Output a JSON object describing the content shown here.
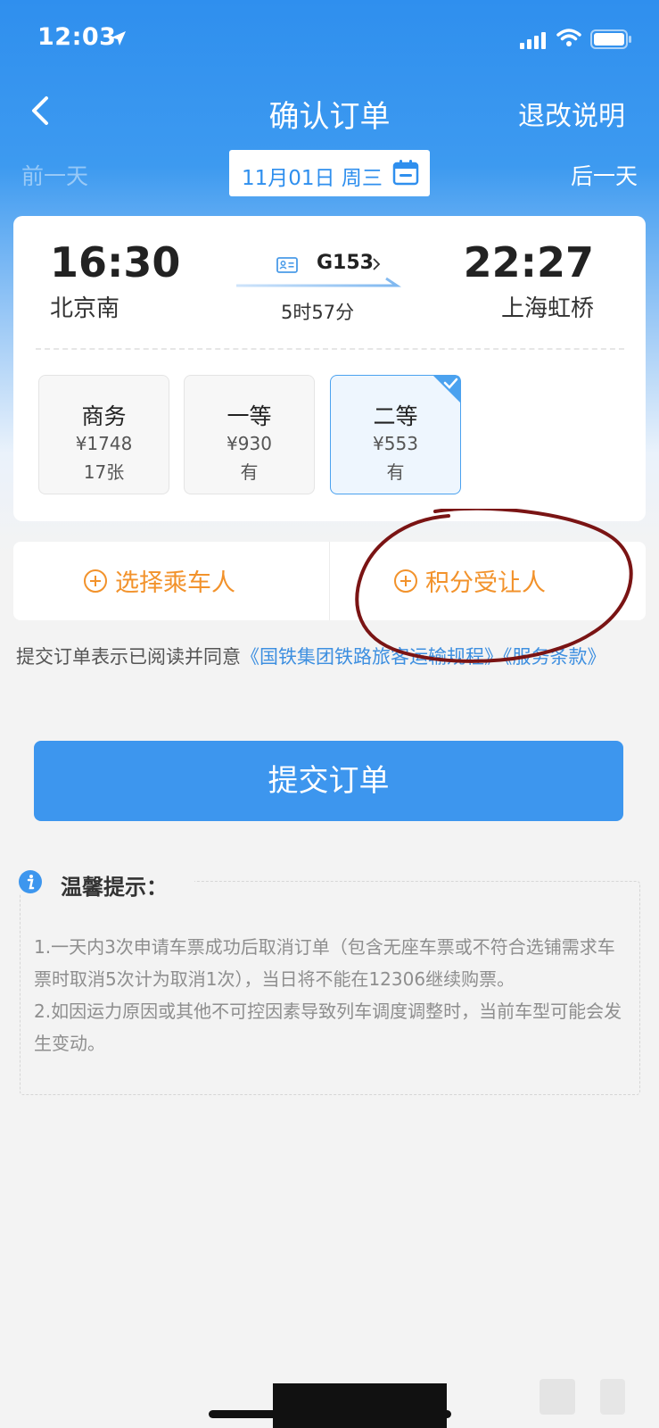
{
  "status_bar": {
    "time": "12:03"
  },
  "nav": {
    "title": "确认订单",
    "right_action": "退改说明"
  },
  "date_bar": {
    "prev": "前一天",
    "date": "11月01日 周三",
    "next": "后一天"
  },
  "train": {
    "departure_time": "16:30",
    "departure_station": "北京南",
    "arrival_time": "22:27",
    "arrival_station": "上海虹桥",
    "number": "G153",
    "duration": "5时57分"
  },
  "seats": [
    {
      "name": "商务",
      "price": "¥1748",
      "availability": "17张",
      "selected": false
    },
    {
      "name": "一等",
      "price": "¥930",
      "availability": "有",
      "selected": false
    },
    {
      "name": "二等",
      "price": "¥553",
      "availability": "有",
      "selected": true
    }
  ],
  "passenger_actions": {
    "select_passenger": "选择乘车人",
    "points_beneficiary": "积分受让人"
  },
  "agreement": {
    "prefix": "提交订单表示已阅读并同意",
    "link1": "《国铁集团铁路旅客运输规程》",
    "link2": "《服务条款》"
  },
  "submit_label": "提交订单",
  "tips": {
    "title": "温馨提示：",
    "items": [
      "1.一天内3次申请车票成功后取消订单（包含无座车票或不符合选铺需求车票时取消5次计为取消1次），当日将不能在12306继续购票。",
      "2.如因运力原因或其他不可控因素导致列车调度调整时，当前车型可能会发生变动。"
    ]
  },
  "colors": {
    "primary": "#3d96ee",
    "accent_orange": "#f2922b",
    "link": "#3d8fe0",
    "annotation": "#7a1414"
  }
}
